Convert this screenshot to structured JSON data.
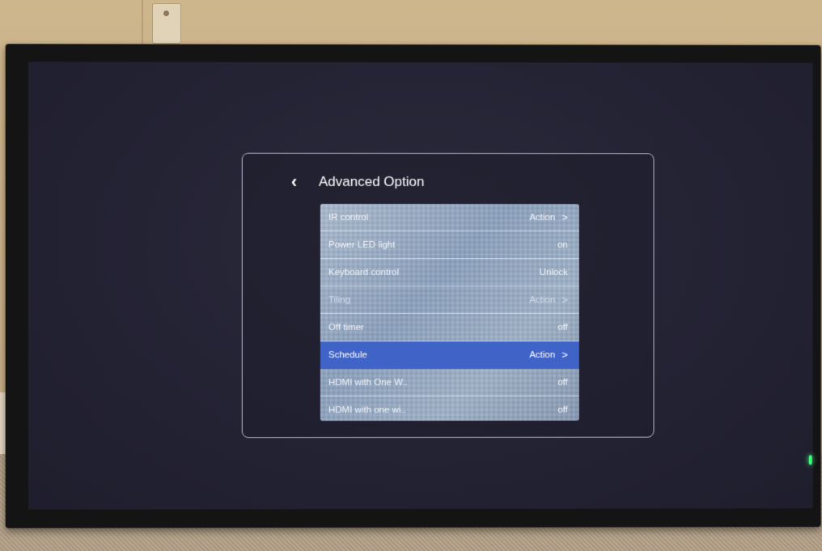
{
  "dialog": {
    "title": "Advanced Option",
    "back_icon": "chevron-left-icon"
  },
  "menu": {
    "items": [
      {
        "label": "IR control",
        "value": "Action",
        "chevron": ">"
      },
      {
        "label": "Power LED light",
        "value": "on",
        "chevron": ""
      },
      {
        "label": "Keyboard control",
        "value": "Unlock",
        "chevron": ""
      },
      {
        "label": "Tiling",
        "value": "Action",
        "chevron": ">"
      },
      {
        "label": "Off timer",
        "value": "off",
        "chevron": ""
      },
      {
        "label": "Schedule",
        "value": "Action",
        "chevron": ">"
      },
      {
        "label": "HDMI with One W..",
        "value": "off",
        "chevron": ""
      },
      {
        "label": "HDMI with one wi..",
        "value": "off",
        "chevron": ""
      }
    ],
    "selected_label": "Schedule",
    "selected_color": "#3f63c7"
  },
  "monitor": {
    "power_led_color": "#3dff7a"
  }
}
